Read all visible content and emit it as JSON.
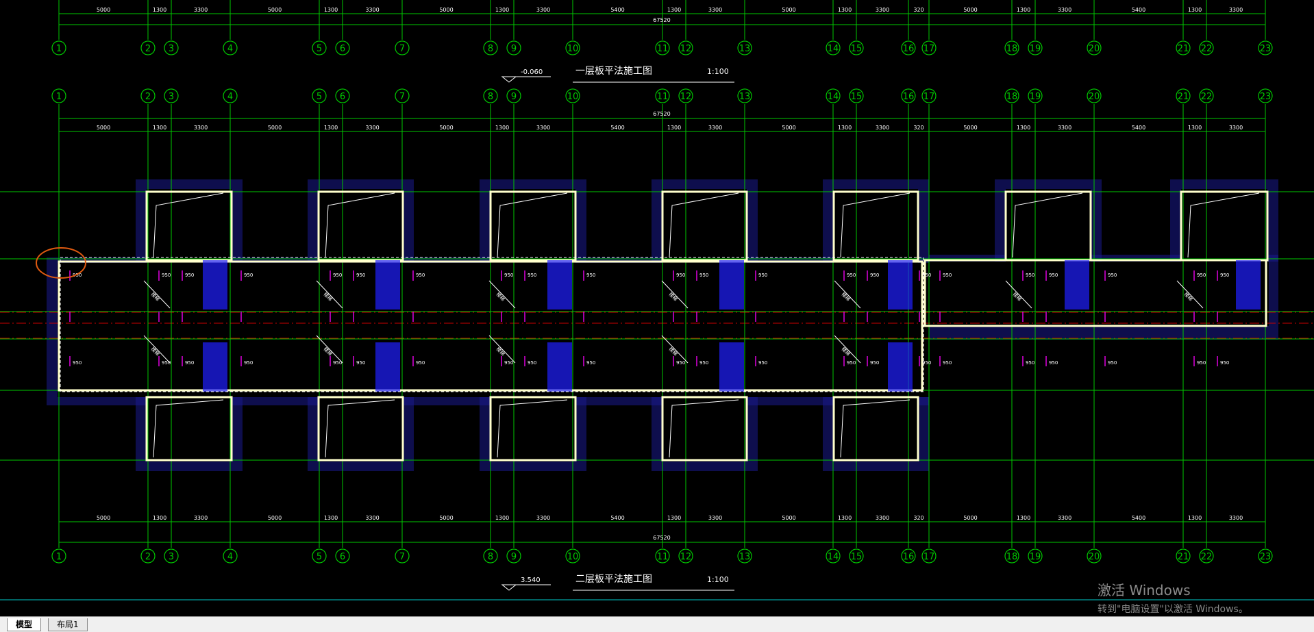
{
  "app": "CAD drawing viewer",
  "colors": {
    "background": "#000000",
    "axis_line": "#00c800",
    "axis_bubble": "#00c800",
    "center_line": "#c80000",
    "wall": "#ffffcc",
    "slab_hatch": "#1a1a8c",
    "stair_hatch": "#2020ff",
    "annotation": "#e000e0",
    "dimension_text": "#ffffff",
    "highlight_circle": "#e05a10",
    "cyan_line": "#00c8c8"
  },
  "axis_labels": [
    "1",
    "2",
    "3",
    "4",
    "5",
    "6",
    "7",
    "8",
    "9",
    "10",
    "11",
    "12",
    "13",
    "14",
    "15",
    "16",
    "17",
    "18",
    "19",
    "20",
    "21",
    "22",
    "23"
  ],
  "dim_segments": [
    "5000",
    "1300",
    "3300",
    "5000",
    "1300",
    "3300",
    "5000",
    "1300",
    "3300",
    "5400",
    "1300",
    "3300",
    "5000",
    "1300",
    "3300",
    "320",
    "5000",
    "1300",
    "3300",
    "5400",
    "1300",
    "3300"
  ],
  "total_dim": "67520",
  "plans": [
    {
      "level": "-0.060",
      "title": "一层板平法施工图",
      "scale": "1:100"
    },
    {
      "level": "3.540",
      "title": "二层板平法施工图",
      "scale": "1:100"
    }
  ],
  "slab_label": "950",
  "stair_label": "楼梯",
  "tabs": [
    {
      "label": "模型",
      "active": true
    },
    {
      "label": "布局1",
      "active": false
    }
  ],
  "watermark": {
    "title": "激活 Windows",
    "subtitle": "转到\"电脑设置\"以激活 Windows。"
  }
}
